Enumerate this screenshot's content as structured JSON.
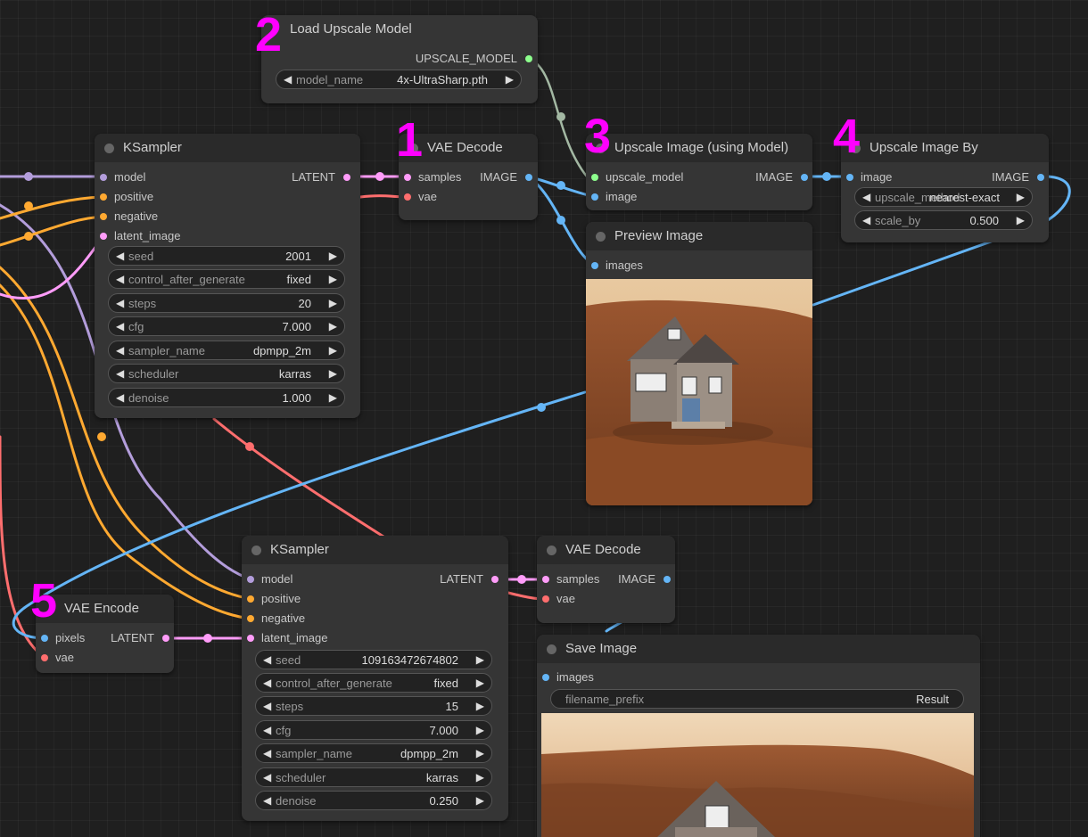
{
  "colors": {
    "model": "#b39ddb",
    "conditioning": "#ffa931",
    "latent": "#ff9cf9",
    "vae": "#ff6e6e",
    "image": "#64b5f6",
    "upscale_model": "#8dff8d",
    "marker": "#ff00ff",
    "node_bg": "#353535",
    "title_bg": "#2a2a2a"
  },
  "markers": [
    "2",
    "1",
    "3",
    "4",
    "5"
  ],
  "nodes": {
    "load_upscale": {
      "title": "Load Upscale Model",
      "outputs": [
        "UPSCALE_MODEL"
      ],
      "widgets": [
        {
          "label": "model_name",
          "value": "4x-UltraSharp.pth"
        }
      ]
    },
    "ksampler1": {
      "title": "KSampler",
      "inputs": [
        "model",
        "positive",
        "negative",
        "latent_image"
      ],
      "outputs": [
        "LATENT"
      ],
      "widgets": [
        {
          "label": "seed",
          "value": "2001"
        },
        {
          "label": "control_after_generate",
          "value": "fixed"
        },
        {
          "label": "steps",
          "value": "20"
        },
        {
          "label": "cfg",
          "value": "7.000"
        },
        {
          "label": "sampler_name",
          "value": "dpmpp_2m"
        },
        {
          "label": "scheduler",
          "value": "karras"
        },
        {
          "label": "denoise",
          "value": "1.000"
        }
      ]
    },
    "vae_decode1": {
      "title": "VAE Decode",
      "inputs": [
        "samples",
        "vae"
      ],
      "outputs": [
        "IMAGE"
      ]
    },
    "upscale_model_node": {
      "title": "Upscale Image (using Model)",
      "inputs": [
        "upscale_model",
        "image"
      ],
      "outputs": [
        "IMAGE"
      ]
    },
    "upscale_by": {
      "title": "Upscale Image By",
      "inputs": [
        "image"
      ],
      "outputs": [
        "IMAGE"
      ],
      "widgets": [
        {
          "label": "upscale_method",
          "value": "nearest-exact"
        },
        {
          "label": "scale_by",
          "value": "0.500"
        }
      ]
    },
    "preview": {
      "title": "Preview Image",
      "inputs": [
        "images"
      ]
    },
    "vae_encode": {
      "title": "VAE Encode",
      "inputs": [
        "pixels",
        "vae"
      ],
      "outputs": [
        "LATENT"
      ]
    },
    "ksampler2": {
      "title": "KSampler",
      "inputs": [
        "model",
        "positive",
        "negative",
        "latent_image"
      ],
      "outputs": [
        "LATENT"
      ],
      "widgets": [
        {
          "label": "seed",
          "value": "109163472674802"
        },
        {
          "label": "control_after_generate",
          "value": "fixed"
        },
        {
          "label": "steps",
          "value": "15"
        },
        {
          "label": "cfg",
          "value": "7.000"
        },
        {
          "label": "sampler_name",
          "value": "dpmpp_2m"
        },
        {
          "label": "scheduler",
          "value": "karras"
        },
        {
          "label": "denoise",
          "value": "0.250"
        }
      ]
    },
    "vae_decode2": {
      "title": "VAE Decode",
      "inputs": [
        "samples",
        "vae"
      ],
      "outputs": [
        "IMAGE"
      ]
    },
    "save_image": {
      "title": "Save Image",
      "inputs": [
        "images"
      ],
      "widgets": [
        {
          "label": "filename_prefix",
          "value": "Result"
        }
      ]
    }
  }
}
